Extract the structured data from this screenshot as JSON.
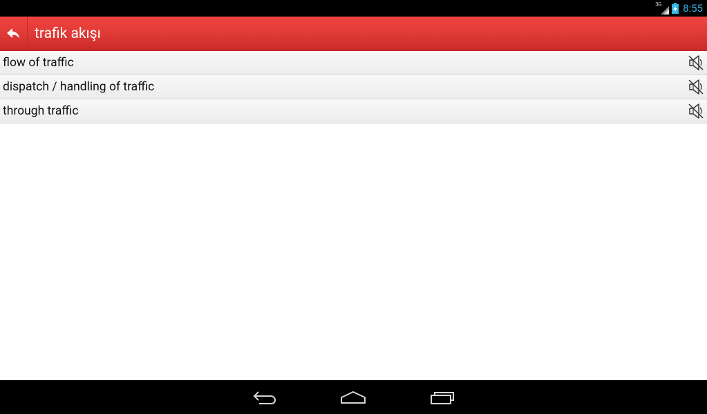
{
  "status_bar": {
    "network_type": "3G",
    "time": "8:55",
    "time_color": "#33b5e5",
    "icons": [
      "signal-icon",
      "battery-charging-icon"
    ]
  },
  "action_bar": {
    "title": "trafik akışı",
    "back_icon": "reply-arrow-icon",
    "colors": {
      "top": "#ee4441",
      "bottom": "#c92b2a"
    }
  },
  "results": [
    {
      "text": "flow of traffic",
      "icon": "speaker-muted-icon"
    },
    {
      "text": "dispatch / handling of traffic",
      "icon": "speaker-muted-icon"
    },
    {
      "text": "through traffic",
      "icon": "speaker-muted-icon"
    }
  ],
  "nav_bar": {
    "buttons": [
      "back-icon",
      "home-icon",
      "recent-apps-icon"
    ]
  }
}
